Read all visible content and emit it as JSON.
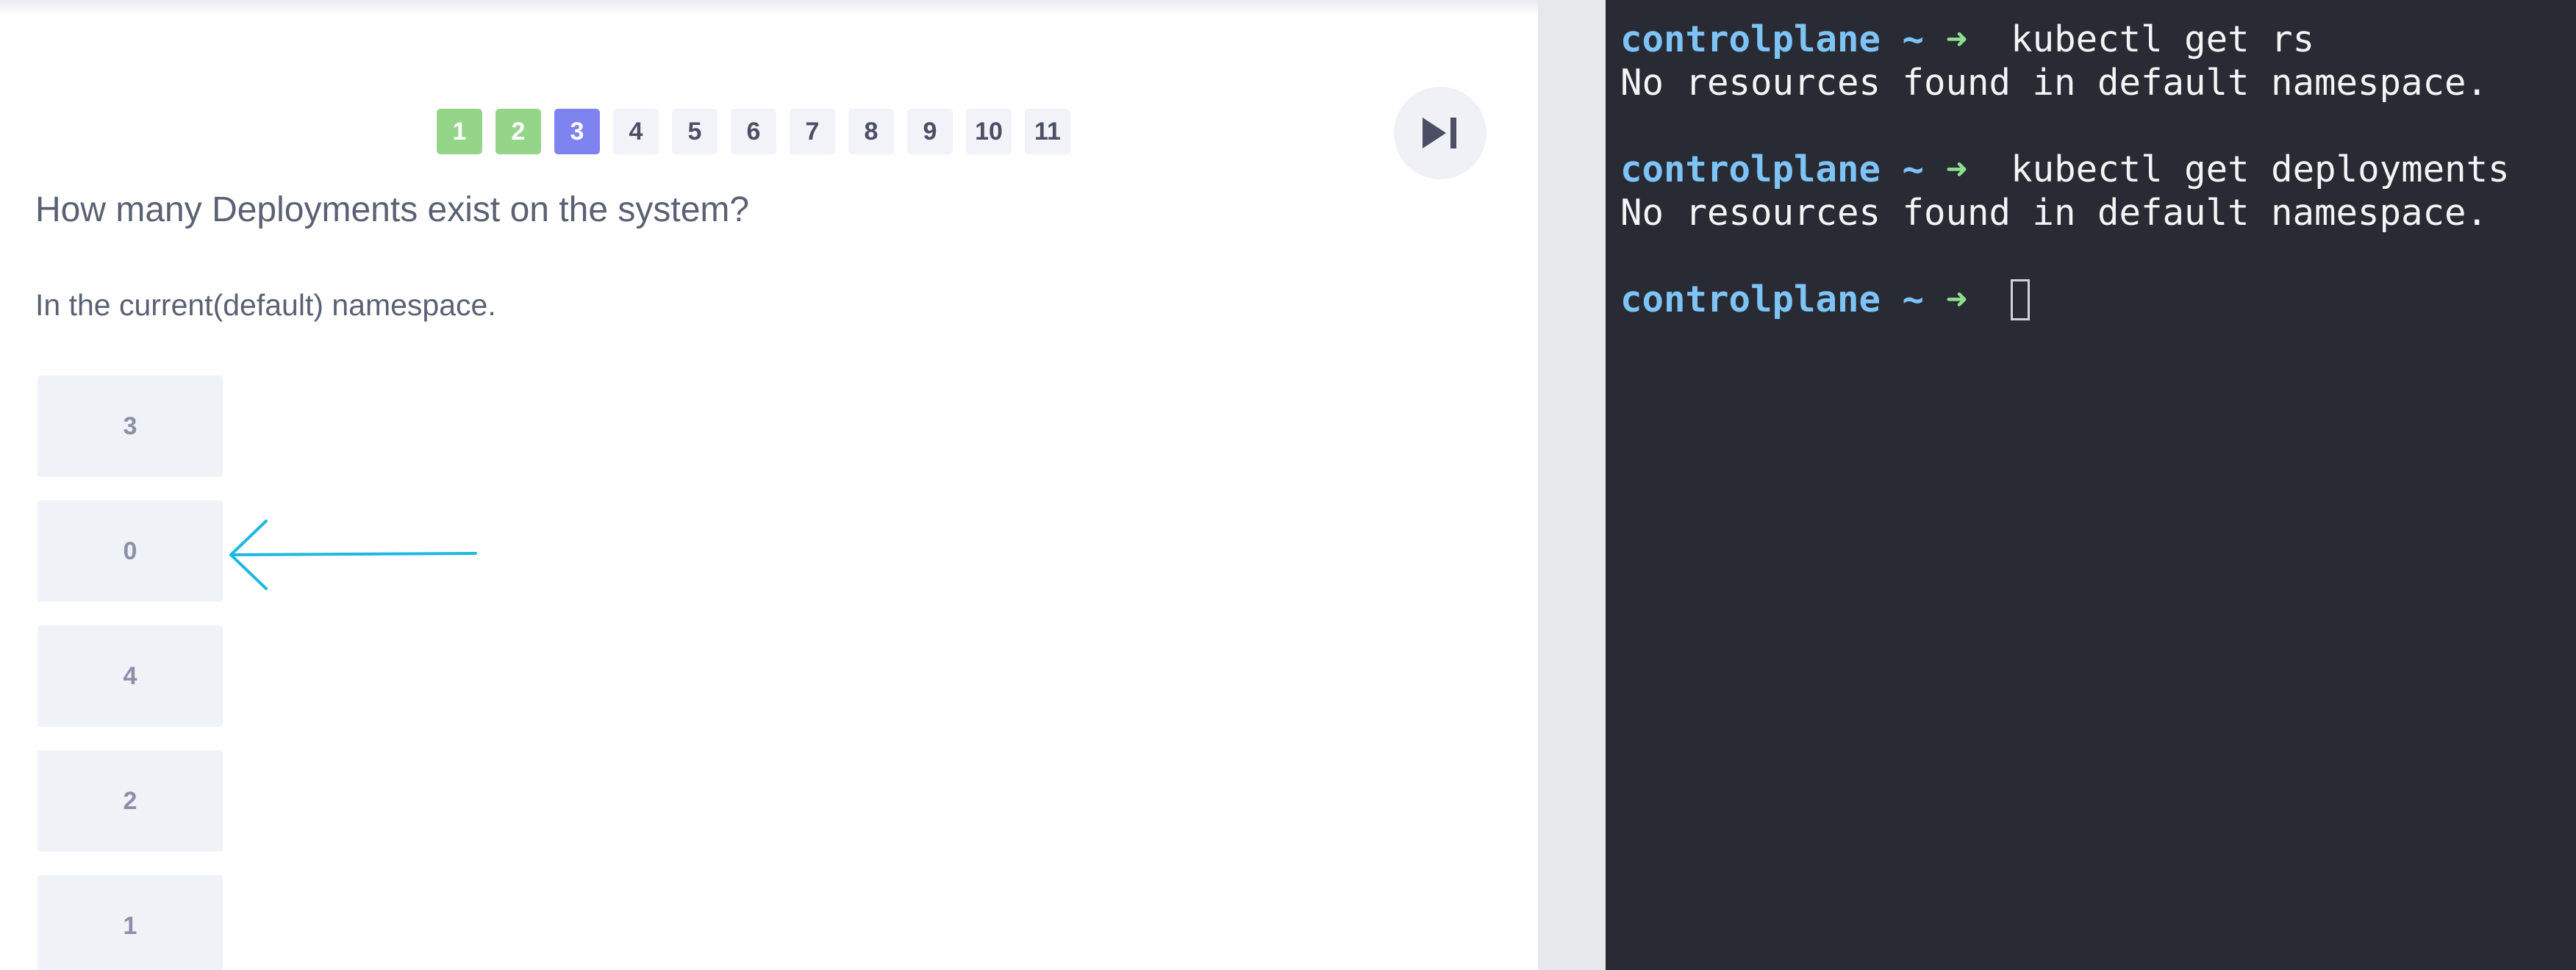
{
  "pagination": {
    "pages": [
      {
        "label": "1",
        "state": "done"
      },
      {
        "label": "2",
        "state": "done"
      },
      {
        "label": "3",
        "state": "current"
      },
      {
        "label": "4",
        "state": "todo"
      },
      {
        "label": "5",
        "state": "todo"
      },
      {
        "label": "6",
        "state": "todo"
      },
      {
        "label": "7",
        "state": "todo"
      },
      {
        "label": "8",
        "state": "todo"
      },
      {
        "label": "9",
        "state": "todo"
      },
      {
        "label": "10",
        "state": "todo"
      },
      {
        "label": "11",
        "state": "todo"
      }
    ],
    "skip_icon": "skip-next-icon"
  },
  "question": {
    "text": "How many Deployments exist on the system?",
    "hint": "In the current(default) namespace."
  },
  "options": [
    "3",
    "0",
    "4",
    "2",
    "1"
  ],
  "annotation": {
    "type": "arrow",
    "points_to_option": "0",
    "color": "#1fb8e0"
  },
  "terminal": {
    "lines": [
      {
        "type": "prompt",
        "host": "controlplane",
        "tilde": "~",
        "arrow": "➜",
        "command": "kubectl get rs"
      },
      {
        "type": "output",
        "text": "No resources found in default namespace."
      },
      {
        "type": "blank",
        "text": ""
      },
      {
        "type": "prompt",
        "host": "controlplane",
        "tilde": "~",
        "arrow": "➜",
        "command": "kubectl get deployments"
      },
      {
        "type": "output",
        "text": "No resources found in default namespace."
      },
      {
        "type": "blank",
        "text": ""
      },
      {
        "type": "prompt",
        "host": "controlplane",
        "tilde": "~",
        "arrow": "➜",
        "command": "",
        "cursor": true
      }
    ]
  },
  "colors": {
    "done": "#95d58a",
    "current": "#7f83f0",
    "terminal_bg": "#282b34",
    "prompt_host": "#7ec3f5",
    "prompt_arrow": "#8ee08a"
  }
}
